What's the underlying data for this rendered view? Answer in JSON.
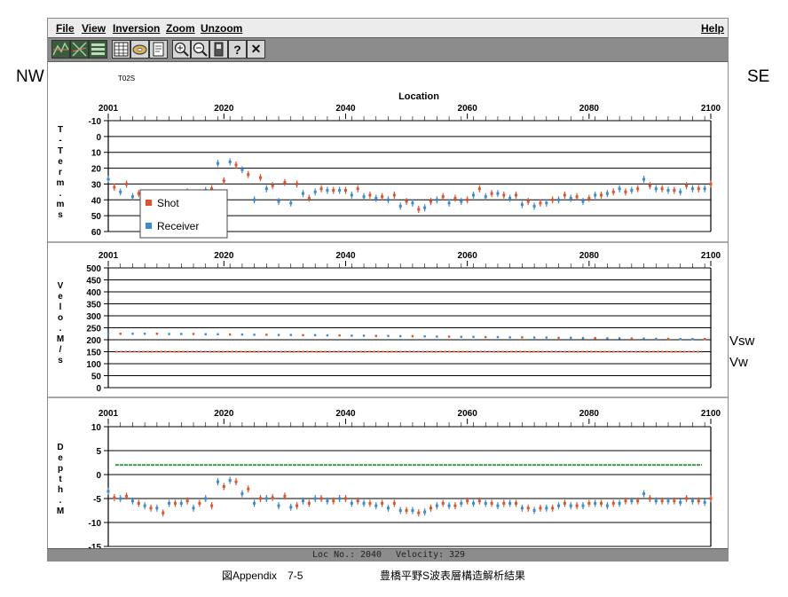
{
  "side_labels": {
    "left": "NW",
    "right": "SE",
    "vsw": "Vsw",
    "vw": "Vw"
  },
  "menu": [
    "File",
    "View",
    "Inversion",
    "Zoom",
    "Unzoom"
  ],
  "help": "Help",
  "toolbar_icons": [
    "line-view-icon",
    "cross-view-icon",
    "layers-icon",
    "table-icon",
    "disk-icon",
    "document-icon",
    "zoom-in-icon",
    "zoom-out-icon",
    "device-icon",
    "help-icon",
    "close-icon"
  ],
  "toolbar_glyphs": {
    "help-icon": "?",
    "close-icon": "✕"
  },
  "profile_id": "T02S",
  "x_axis_title": "Location",
  "status": {
    "loc_label": "Loc No.:",
    "loc_value": "2040",
    "vel_label": "Velocity:",
    "vel_value": "329"
  },
  "caption": {
    "left": "図Appendix　7-5",
    "right": "豊橋平野S波表層構造解析結果"
  },
  "colors": {
    "shot": "#e0532a",
    "receiver": "#3a8ad4",
    "green": "#2f9a3a",
    "grid": "#000000"
  },
  "chart_data": [
    {
      "type": "scatter",
      "name": "term",
      "ylabel": "T-Term. ms",
      "ylim": [
        -10,
        60
      ],
      "y_inverted": true,
      "yticks": [
        -10,
        0,
        10,
        20,
        30,
        40,
        50,
        60
      ],
      "xlim": [
        2001,
        2100
      ],
      "xticks": [
        2001,
        2020,
        2040,
        2060,
        2080,
        2100
      ],
      "legend": {
        "placement": "top-left",
        "entries": [
          "Shot",
          "Receiver"
        ]
      },
      "series": [
        {
          "name": "Shot",
          "color": "#e0532a",
          "x": [
            2002,
            2004,
            2006,
            2008,
            2010,
            2012,
            2014,
            2016,
            2018,
            2020,
            2022,
            2024,
            2026,
            2028,
            2030,
            2032,
            2034,
            2036,
            2038,
            2040,
            2042,
            2044,
            2046,
            2048,
            2050,
            2052,
            2054,
            2056,
            2058,
            2060,
            2062,
            2064,
            2066,
            2068,
            2070,
            2072,
            2074,
            2076,
            2078,
            2080,
            2082,
            2084,
            2086,
            2088,
            2090,
            2092,
            2094,
            2096,
            2098,
            2100
          ],
          "y": [
            32,
            30,
            36,
            37,
            37,
            36,
            35,
            36,
            33,
            28,
            18,
            24,
            26,
            31,
            29,
            30,
            39,
            33,
            34,
            34,
            33,
            37,
            38,
            37,
            41,
            46,
            41,
            38,
            39,
            40,
            33,
            36,
            37,
            37,
            41,
            42,
            40,
            37,
            38,
            39,
            37,
            35,
            35,
            33,
            31,
            33,
            34,
            31,
            33,
            30
          ]
        },
        {
          "name": "Receiver",
          "color": "#3a8ad4",
          "x": [
            2001,
            2003,
            2005,
            2007,
            2009,
            2011,
            2013,
            2015,
            2017,
            2019,
            2021,
            2023,
            2025,
            2027,
            2029,
            2031,
            2033,
            2035,
            2037,
            2039,
            2041,
            2043,
            2045,
            2047,
            2049,
            2051,
            2053,
            2055,
            2057,
            2059,
            2061,
            2063,
            2065,
            2067,
            2069,
            2071,
            2073,
            2075,
            2077,
            2079,
            2081,
            2083,
            2085,
            2087,
            2089,
            2091,
            2093,
            2095,
            2097,
            2099
          ],
          "y": [
            27,
            35,
            38,
            39,
            37,
            36,
            36,
            37,
            34,
            17,
            16,
            21,
            40,
            33,
            41,
            42,
            36,
            35,
            34,
            34,
            37,
            38,
            39,
            40,
            44,
            42,
            45,
            40,
            42,
            41,
            37,
            38,
            36,
            39,
            43,
            44,
            42,
            40,
            39,
            41,
            37,
            36,
            33,
            34,
            27,
            33,
            34,
            35,
            33,
            33
          ]
        }
      ]
    },
    {
      "type": "scatter",
      "name": "velocity",
      "ylabel": "Velo. M/s",
      "ylim": [
        0,
        500
      ],
      "y_inverted": false,
      "yticks": [
        0,
        50,
        100,
        150,
        200,
        250,
        300,
        350,
        400,
        450,
        500
      ],
      "xlim": [
        2001,
        2100
      ],
      "xticks": [
        2001,
        2020,
        2040,
        2060,
        2080,
        2100
      ],
      "series": [
        {
          "name": "Vsw",
          "color": "#3a8ad4",
          "mixed_colors": true,
          "x": [
            2001,
            2003,
            2005,
            2007,
            2009,
            2011,
            2013,
            2015,
            2017,
            2019,
            2021,
            2023,
            2025,
            2027,
            2029,
            2031,
            2033,
            2035,
            2037,
            2039,
            2041,
            2043,
            2045,
            2047,
            2049,
            2051,
            2053,
            2055,
            2057,
            2059,
            2061,
            2063,
            2065,
            2067,
            2069,
            2071,
            2073,
            2075,
            2077,
            2079,
            2081,
            2083,
            2085,
            2087,
            2089,
            2091,
            2093,
            2095,
            2097,
            2099
          ],
          "y": [
            225,
            225,
            225,
            225,
            225,
            224,
            224,
            224,
            223,
            223,
            222,
            222,
            221,
            221,
            220,
            220,
            219,
            219,
            218,
            218,
            217,
            217,
            216,
            216,
            215,
            215,
            214,
            213,
            213,
            212,
            212,
            211,
            211,
            210,
            210,
            209,
            209,
            208,
            208,
            207,
            207,
            206,
            206,
            205,
            205,
            204,
            204,
            203,
            203,
            203
          ]
        },
        {
          "name": "Vw",
          "color": "#e0532a",
          "constant": 150
        }
      ]
    },
    {
      "type": "scatter",
      "name": "depth",
      "ylabel": "Depth. M",
      "ylim": [
        -15,
        10
      ],
      "y_inverted": false,
      "yticks": [
        -15,
        -10,
        -5,
        0,
        5,
        10
      ],
      "xlim": [
        2001,
        2100
      ],
      "xticks": [
        2001,
        2020,
        2040,
        2060,
        2080,
        2100
      ],
      "series": [
        {
          "name": "surface",
          "color": "#2f9a3a",
          "constant": 2
        },
        {
          "name": "Shot",
          "color": "#e0532a",
          "x": [
            2002,
            2004,
            2006,
            2008,
            2010,
            2012,
            2014,
            2016,
            2018,
            2020,
            2022,
            2024,
            2026,
            2028,
            2030,
            2032,
            2034,
            2036,
            2038,
            2040,
            2042,
            2044,
            2046,
            2048,
            2050,
            2052,
            2054,
            2056,
            2058,
            2060,
            2062,
            2064,
            2066,
            2068,
            2070,
            2072,
            2074,
            2076,
            2078,
            2080,
            2082,
            2084,
            2086,
            2088,
            2090,
            2092,
            2094,
            2096,
            2098,
            2100
          ],
          "y": [
            -4.8,
            -4.5,
            -6,
            -7,
            -8,
            -6,
            -5.5,
            -6,
            -6.5,
            -2.5,
            -1.5,
            -3,
            -5,
            -4.8,
            -4.5,
            -6.5,
            -6,
            -5,
            -5.5,
            -5,
            -5.5,
            -6,
            -6,
            -6,
            -7.5,
            -8,
            -7,
            -6,
            -6.5,
            -5.5,
            -5.5,
            -6,
            -6,
            -6,
            -7,
            -7,
            -7,
            -6,
            -6.5,
            -6,
            -6,
            -6,
            -5.5,
            -5.5,
            -5,
            -5.5,
            -5.5,
            -5,
            -5.5,
            -5
          ]
        },
        {
          "name": "Receiver",
          "color": "#3a8ad4",
          "x": [
            2001,
            2003,
            2005,
            2007,
            2009,
            2011,
            2013,
            2015,
            2017,
            2019,
            2021,
            2023,
            2025,
            2027,
            2029,
            2031,
            2033,
            2035,
            2037,
            2039,
            2041,
            2043,
            2045,
            2047,
            2049,
            2051,
            2053,
            2055,
            2057,
            2059,
            2061,
            2063,
            2065,
            2067,
            2069,
            2071,
            2073,
            2075,
            2077,
            2079,
            2081,
            2083,
            2085,
            2087,
            2089,
            2091,
            2093,
            2095,
            2097,
            2099
          ],
          "y": [
            -3.5,
            -5,
            -5.5,
            -6.5,
            -7,
            -6,
            -6,
            -7,
            -5,
            -1.5,
            -1.2,
            -4,
            -6,
            -5,
            -6.5,
            -6.8,
            -5.5,
            -5,
            -5.5,
            -5,
            -6,
            -6,
            -6.5,
            -7,
            -7.5,
            -7.5,
            -7.8,
            -6.5,
            -6.5,
            -6,
            -6,
            -6,
            -6.5,
            -6,
            -7,
            -7.5,
            -7,
            -6.5,
            -6.5,
            -6.5,
            -6,
            -6.5,
            -6,
            -5.5,
            -4,
            -5.5,
            -5.5,
            -5.8,
            -5.5,
            -5.8
          ]
        }
      ]
    }
  ]
}
